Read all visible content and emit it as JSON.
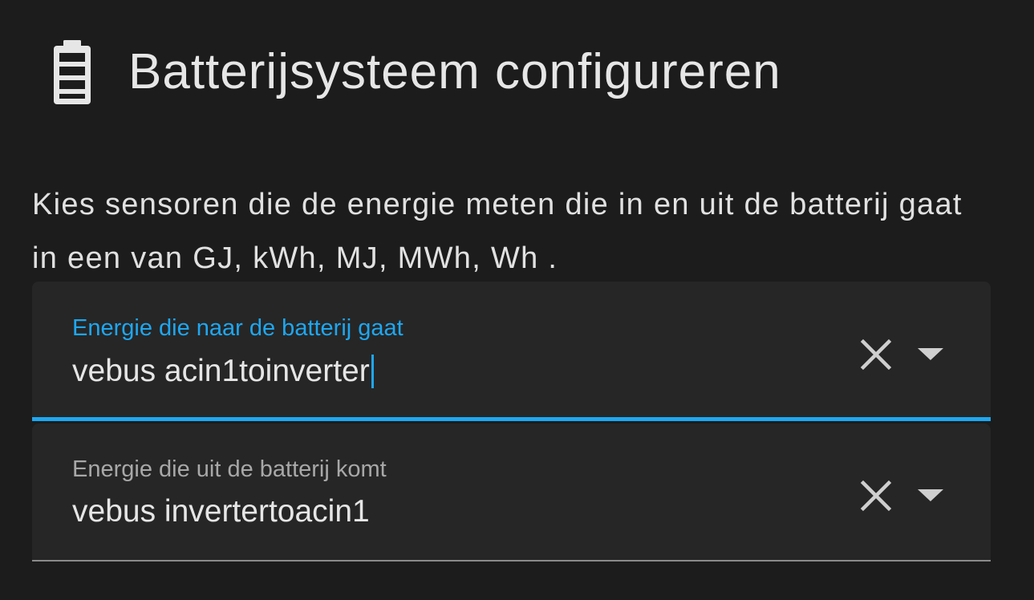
{
  "dialog": {
    "title": "Batterijsysteem configureren",
    "icon": "battery-icon",
    "description": "Kies sensoren die de energie meten die in en uit de batterij gaat in een van GJ, kWh, MJ, MWh, Wh ."
  },
  "fields": {
    "energy_in": {
      "label": "Energie die naar de batterij gaat",
      "value": "vebus acin1toinverter",
      "focused": true
    },
    "energy_out": {
      "label": "Energie die uit de batterij komt",
      "value": "vebus invertertoacin1",
      "focused": false
    }
  },
  "icons": {
    "clear": "close-icon",
    "dropdown": "menu-down-icon"
  },
  "colors": {
    "background": "#1c1c1c",
    "field_background": "#262626",
    "accent": "#1ea7f1",
    "text": "#e1e1e1",
    "label_inactive": "#a8a8a8"
  }
}
